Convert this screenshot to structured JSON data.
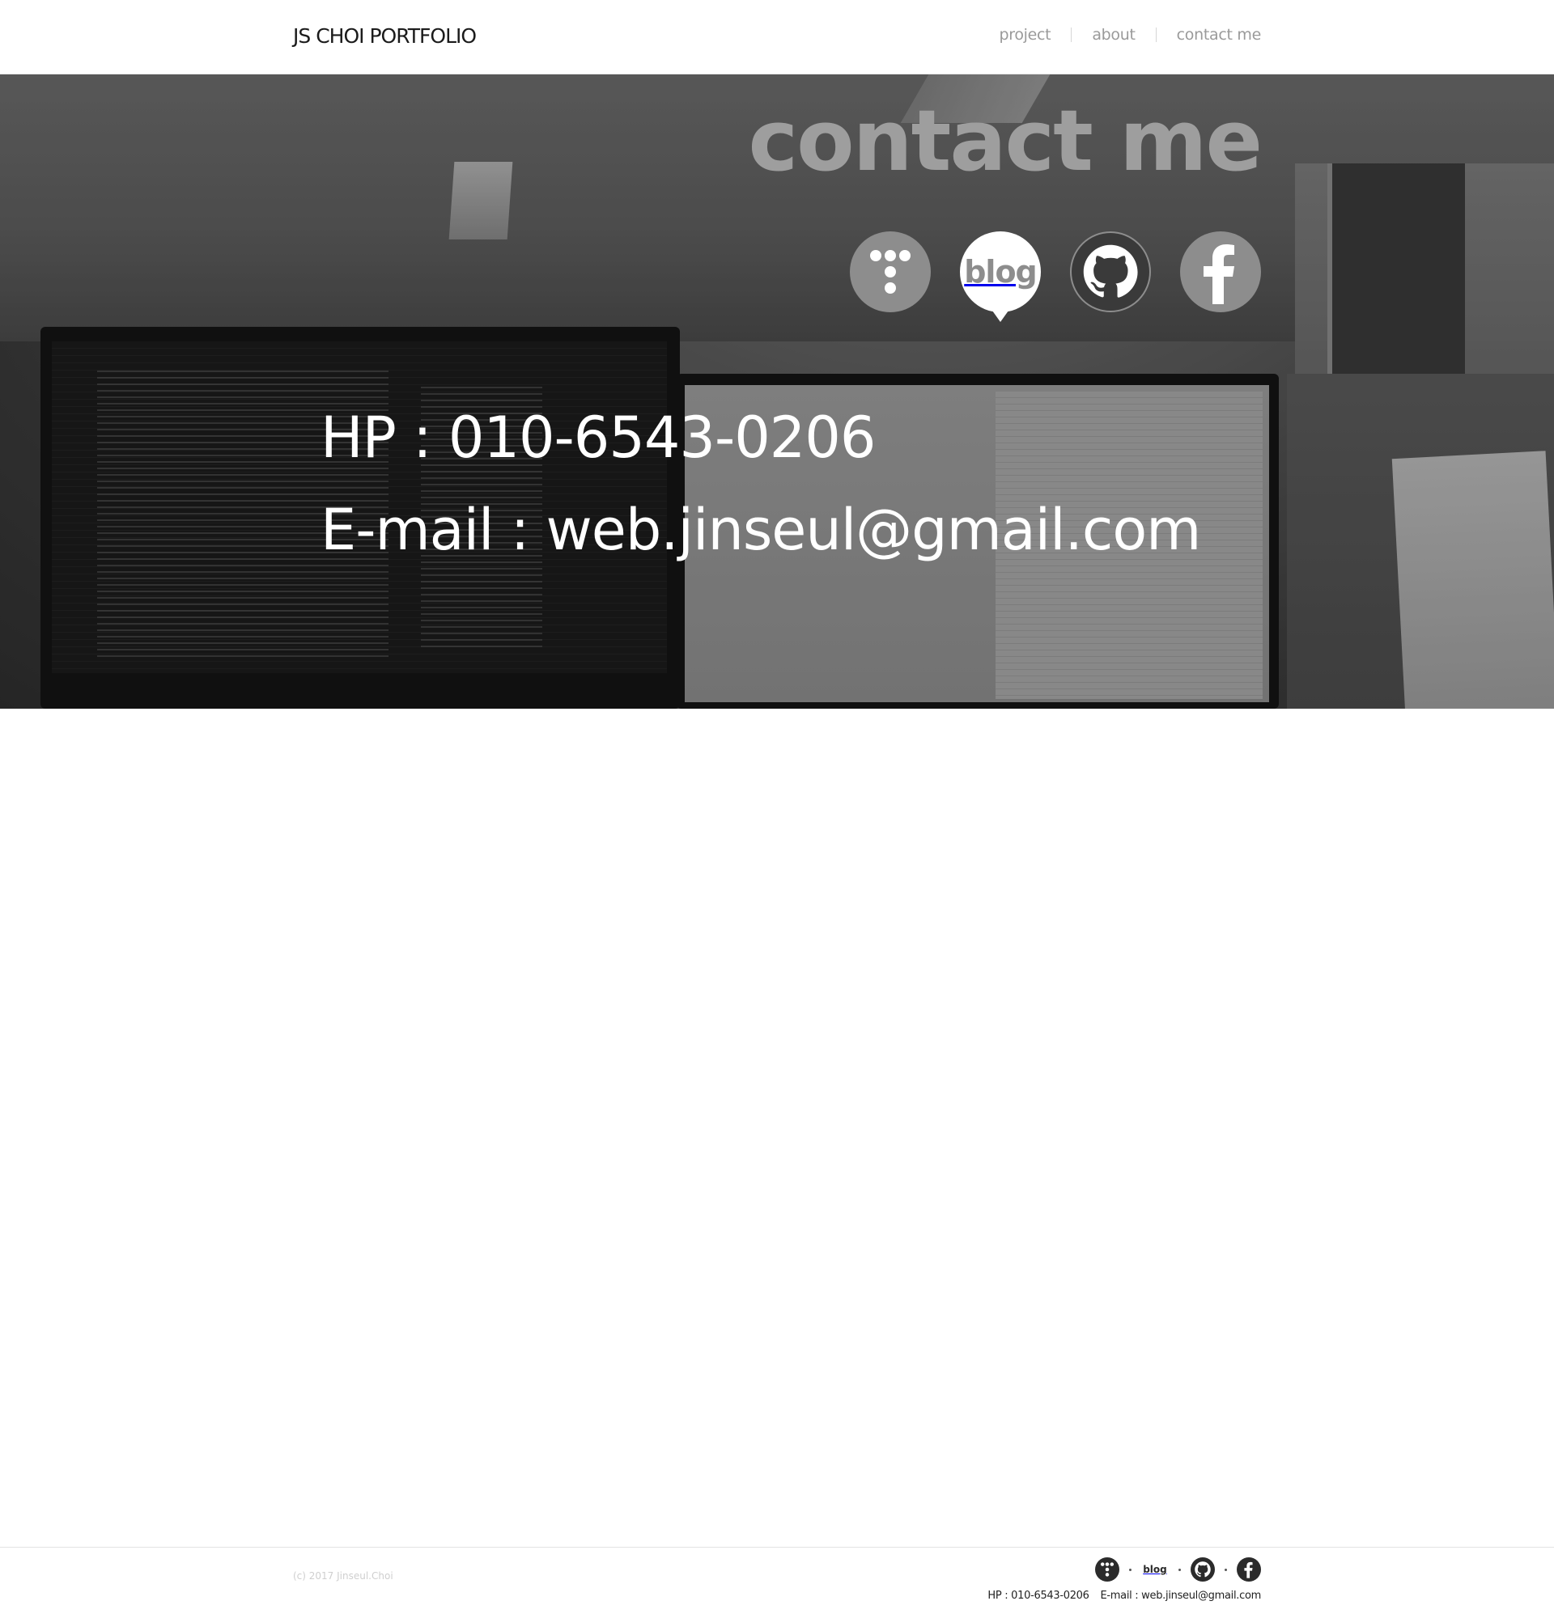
{
  "header": {
    "logo": "JS CHOI PORTFOLIO",
    "nav": [
      {
        "label": "project"
      },
      {
        "label": "about"
      },
      {
        "label": "contact me"
      }
    ]
  },
  "hero": {
    "title": "contact me",
    "social_icons": [
      {
        "name": "tistory-icon"
      },
      {
        "name": "blog-icon",
        "text": "blog"
      },
      {
        "name": "github-icon"
      },
      {
        "name": "facebook-icon"
      }
    ],
    "phone": "HP : 010-6543-0206",
    "email": "E-mail : web.jinseul@gmail.com"
  },
  "footer": {
    "copyright": "(c) 2017 Jinseul.Choi",
    "blog_icon_text": "blog",
    "phone": "HP : 010-6543-0206",
    "email": "E-mail : web.jinseul@gmail.com"
  },
  "colors": {
    "icon_gray": "#8d8d8d",
    "nav_text": "#9a9a9a",
    "title_text": "#9e9e9e"
  }
}
